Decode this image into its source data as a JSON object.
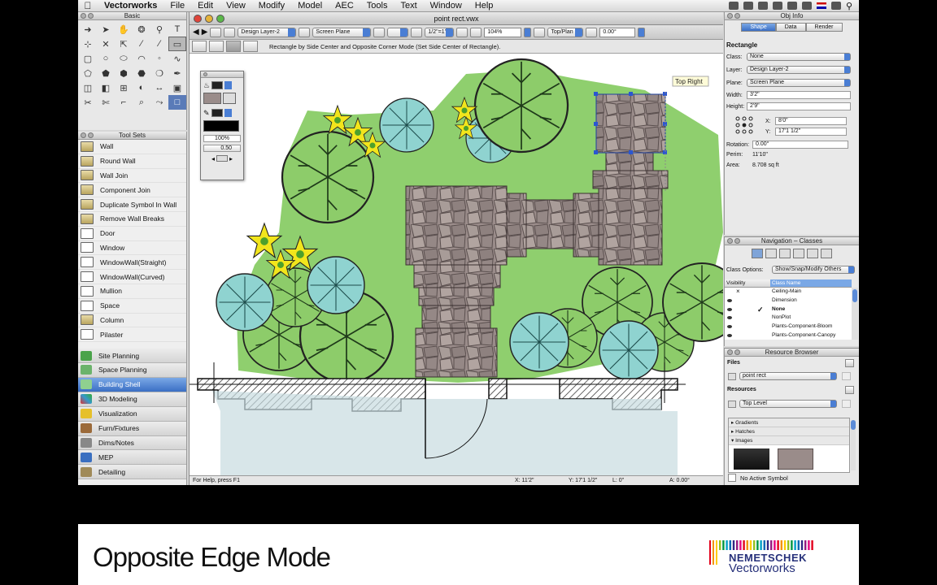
{
  "menubar": {
    "app": "Vectorworks",
    "items": [
      "File",
      "Edit",
      "View",
      "Modify",
      "Model",
      "AEC",
      "Tools",
      "Text",
      "Window",
      "Help"
    ]
  },
  "basic_palette": {
    "title": "Basic"
  },
  "tool_sets": {
    "title": "Tool Sets",
    "tools": [
      "Wall",
      "Round Wall",
      "Wall Join",
      "Component Join",
      "Duplicate Symbol In Wall",
      "Remove Wall Breaks",
      "Door",
      "Window",
      "WindowWall(Straight)",
      "WindowWall(Curved)",
      "Mullion",
      "Space",
      "Column",
      "Pilaster"
    ],
    "sets": [
      "Site Planning",
      "Space Planning",
      "Building Shell",
      "3D Modeling",
      "Visualization",
      "Furn/Fixtures",
      "Dims/Notes",
      "MEP",
      "Detailing"
    ],
    "selected_set": "Building Shell"
  },
  "document": {
    "title": "point rect.vwx",
    "layer": "Design Layer-2",
    "plane": "Screen Plane",
    "scale": "1/2\"=1'",
    "zoom": "104%",
    "view": "Top/Plan",
    "rotation": "0.00°",
    "mode_message": "Rectangle by Side Center and Opposite Corner Mode (Set Side Center of Rectangle).",
    "status_help": "For Help, press F1",
    "status_x": "X: 11'2\"",
    "status_y": "Y: 17'1 1/2\"",
    "status_l": "L: 0\"",
    "status_a": "A: 0.00°",
    "tooltip": "Top Right"
  },
  "attributes_palette": {
    "opacity": "100%",
    "line_weight": "0.50"
  },
  "obj_info": {
    "title": "Obj Info",
    "tabs": [
      "Shape",
      "Data",
      "Render"
    ],
    "active_tab": "Shape",
    "object_type": "Rectangle",
    "class": "None",
    "layer": "Design Layer-2",
    "plane": "Screen Plane",
    "width": "3'2\"",
    "height": "2'9\"",
    "x": "8'0\"",
    "y": "17'1 1/2\"",
    "rotation": "0.00°",
    "perim": "11'10\"",
    "area": "8.708 sq ft",
    "labels": {
      "class": "Class:",
      "layer": "Layer:",
      "plane": "Plane:",
      "width": "Width:",
      "height": "Height:",
      "x": "X:",
      "y": "Y:",
      "rotation": "Rotation:",
      "perim": "Perim:",
      "area": "Area:"
    }
  },
  "navigation": {
    "title": "Navigation – Classes",
    "class_options_label": "Class Options:",
    "class_options": "Show/Snap/Modify Others",
    "col_visibility": "Visibility",
    "col_name": "Class Name",
    "classes": [
      "Ceiling-Main",
      "Dimension",
      "None",
      "NonPlot",
      "Plants-Component-Bloom",
      "Plants-Component-Canopy"
    ]
  },
  "resource_browser": {
    "title": "Resource Browser",
    "files_label": "Files",
    "file": "point rect",
    "resources_label": "Resources",
    "level": "Top Level",
    "folders": [
      "Gradients",
      "Hatches",
      "Images"
    ],
    "active_symbol": "No Active Symbol"
  },
  "caption": {
    "text": "Opposite Edge Mode",
    "brand_top": "NEMETSCHEK",
    "brand_bottom": "Vectorworks",
    "stripe_colors": [
      "#e3001b",
      "#f39200",
      "#ffcc00",
      "#95c11f",
      "#009640",
      "#00a0c6",
      "#0069b4",
      "#312783",
      "#951b81",
      "#e6007e",
      "#e3001b",
      "#f39200",
      "#ffcc00",
      "#95c11f",
      "#009640",
      "#00a0c6",
      "#0069b4",
      "#312783",
      "#951b81",
      "#e6007e",
      "#e3001b",
      "#f39200",
      "#ffcc00",
      "#95c11f",
      "#009640",
      "#00a0c6",
      "#0069b4",
      "#312783",
      "#951b81",
      "#e6007e",
      "#e3001b"
    ]
  }
}
